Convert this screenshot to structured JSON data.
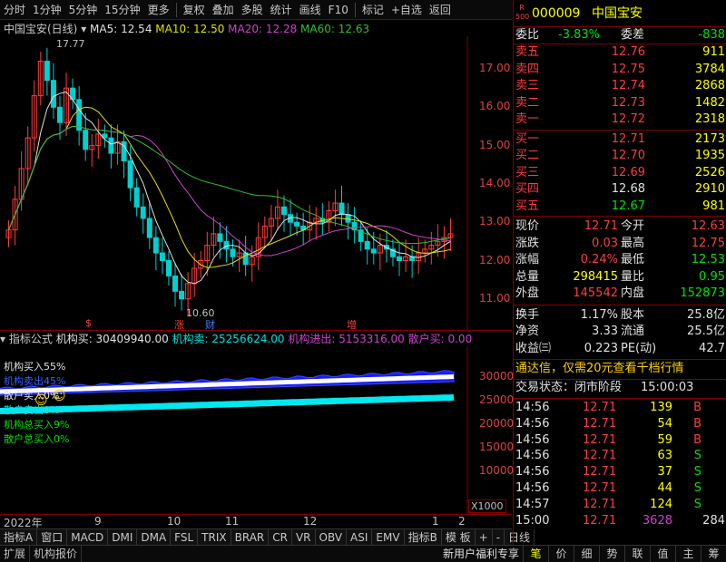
{
  "toolbar": {
    "items": [
      "分时",
      "1分钟",
      "5分钟",
      "15分钟",
      "更多",
      "复权",
      "叠加",
      "多股",
      "统计",
      "画线",
      "F10",
      "标记",
      "+自选",
      "返回"
    ]
  },
  "main": {
    "stock_label": "中国宝安(日线)",
    "ma5": "MA5: 12.54",
    "ma10": "MA10: 12.50",
    "ma20": "MA20: 12.28",
    "ma60": "MA60: 12.63",
    "high_label": "17.77",
    "low_label": "10.60",
    "markers": [
      "$",
      "涨",
      "财",
      "增"
    ],
    "colors": {
      "ma5": "#e0e0e0",
      "ma10": "#e0e000",
      "ma20": "#d040d0",
      "ma60": "#30c030",
      "up": "#ff3c3c",
      "down": "#00d0d0"
    }
  },
  "chart_data": [
    {
      "type": "candlestick",
      "title": "中国宝安(日线)",
      "ylim": [
        10.6,
        17.77
      ],
      "yticks": [
        "17.00",
        "16.00",
        "15.00",
        "14.00",
        "13.00",
        "12.00",
        "11.00"
      ],
      "series": [
        {
          "name": "MA5",
          "values": [
            12.54
          ]
        },
        {
          "name": "MA10",
          "values": [
            12.5
          ]
        },
        {
          "name": "MA20",
          "values": [
            12.28
          ]
        },
        {
          "name": "MA60",
          "values": [
            12.63
          ]
        }
      ],
      "xticks": [
        "2022年",
        "9",
        "10",
        "11",
        "12",
        "1",
        "2"
      ]
    },
    {
      "type": "area",
      "title": "指标公式",
      "yticks": [
        "30000",
        "25000",
        "20000",
        "15000",
        "10000"
      ],
      "unit": "X1000",
      "series": [
        {
          "name": "机构买",
          "values": [
            30409940.0
          ]
        },
        {
          "name": "机构卖",
          "values": [
            25256624.0
          ]
        },
        {
          "name": "机构进出",
          "values": [
            5153316.0
          ]
        },
        {
          "name": "散户买",
          "values": [
            0.0
          ]
        }
      ]
    }
  ],
  "lower": {
    "header": "指标公式",
    "b1": "机构买: 30409940.00",
    "b2": "机构卖: 25256624.00",
    "b3": "机构进出: 5153316.00",
    "b4": "散户买: 0.00",
    "legend": [
      "机构买入55%",
      "机构卖出45%",
      "散户买入0%",
      "散户卖出0%",
      "机构总买入9%",
      "散户总买入0%"
    ]
  },
  "tabs": [
    "指标A",
    "窗口",
    "MACD",
    "DMI",
    "DMA",
    "FSL",
    "TRIX",
    "BRAR",
    "CR",
    "VR",
    "OBV",
    "ASI",
    "EMV",
    "指标B",
    "模 板",
    "+",
    "-",
    "日线"
  ],
  "bottom": {
    "left": [
      "扩展",
      "机构报价"
    ],
    "center": "新用户福利专享",
    "right": [
      "笔",
      "价",
      "细",
      "势",
      "联",
      "值",
      "主",
      "筹"
    ]
  },
  "quote": {
    "code": "000009",
    "name": "中国宝安",
    "badge_r": "R",
    "badge_n": "500",
    "weibi_l": "委比",
    "weibi_v": "-3.83%",
    "weicha_l": "委差",
    "weicha_v": "-838",
    "asks": [
      {
        "l": "卖五",
        "p": "12.76",
        "v": "911"
      },
      {
        "l": "卖四",
        "p": "12.75",
        "v": "3784"
      },
      {
        "l": "卖三",
        "p": "12.74",
        "v": "2868"
      },
      {
        "l": "卖二",
        "p": "12.73",
        "v": "1482"
      },
      {
        "l": "卖一",
        "p": "12.72",
        "v": "2318"
      }
    ],
    "bids": [
      {
        "l": "买一",
        "p": "12.71",
        "v": "2173"
      },
      {
        "l": "买二",
        "p": "12.70",
        "v": "1935"
      },
      {
        "l": "买三",
        "p": "12.69",
        "v": "2526"
      },
      {
        "l": "买四",
        "p": "12.68",
        "v": "2910"
      },
      {
        "l": "买五",
        "p": "12.67",
        "v": "981"
      }
    ],
    "stats": [
      {
        "l": "现价",
        "v": "12.71",
        "l2": "今开",
        "v2": "12.63"
      },
      {
        "l": "涨跌",
        "v": "0.03",
        "l2": "最高",
        "v2": "12.75"
      },
      {
        "l": "涨幅",
        "v": "0.24%",
        "l2": "最低",
        "v2": "12.53"
      },
      {
        "l": "总量",
        "v": "298415",
        "l2": "量比",
        "v2": "0.95"
      },
      {
        "l": "外盘",
        "v": "145542",
        "l2": "内盘",
        "v2": "152873"
      }
    ],
    "stats2": [
      {
        "l": "换手",
        "v": "1.17%",
        "l2": "股本",
        "v2": "25.8亿"
      },
      {
        "l": "净资",
        "v": "3.33",
        "l2": "流通",
        "v2": "25.5亿"
      },
      {
        "l": "收益㈢",
        "v": "0.223",
        "l2": "PE(动)",
        "v2": "42.7"
      }
    ],
    "ad": "通达信，仅需20元查看千档行情",
    "status": "交易状态：闭市阶段",
    "status_time": "15:00:03",
    "ticks": [
      {
        "t": "14:56",
        "p": "12.71",
        "v": "139",
        "s": "B"
      },
      {
        "t": "14:56",
        "p": "12.71",
        "v": "54",
        "s": "B"
      },
      {
        "t": "14:56",
        "p": "12.71",
        "v": "59",
        "s": "B"
      },
      {
        "t": "14:56",
        "p": "12.71",
        "v": "63",
        "s": "S"
      },
      {
        "t": "14:56",
        "p": "12.71",
        "v": "37",
        "s": "S"
      },
      {
        "t": "14:56",
        "p": "12.71",
        "v": "44",
        "s": "S"
      },
      {
        "t": "14:57",
        "p": "12.71",
        "v": "124",
        "s": "S"
      },
      {
        "t": "15:00",
        "p": "12.71",
        "v": "3628",
        "s": "284"
      }
    ]
  }
}
